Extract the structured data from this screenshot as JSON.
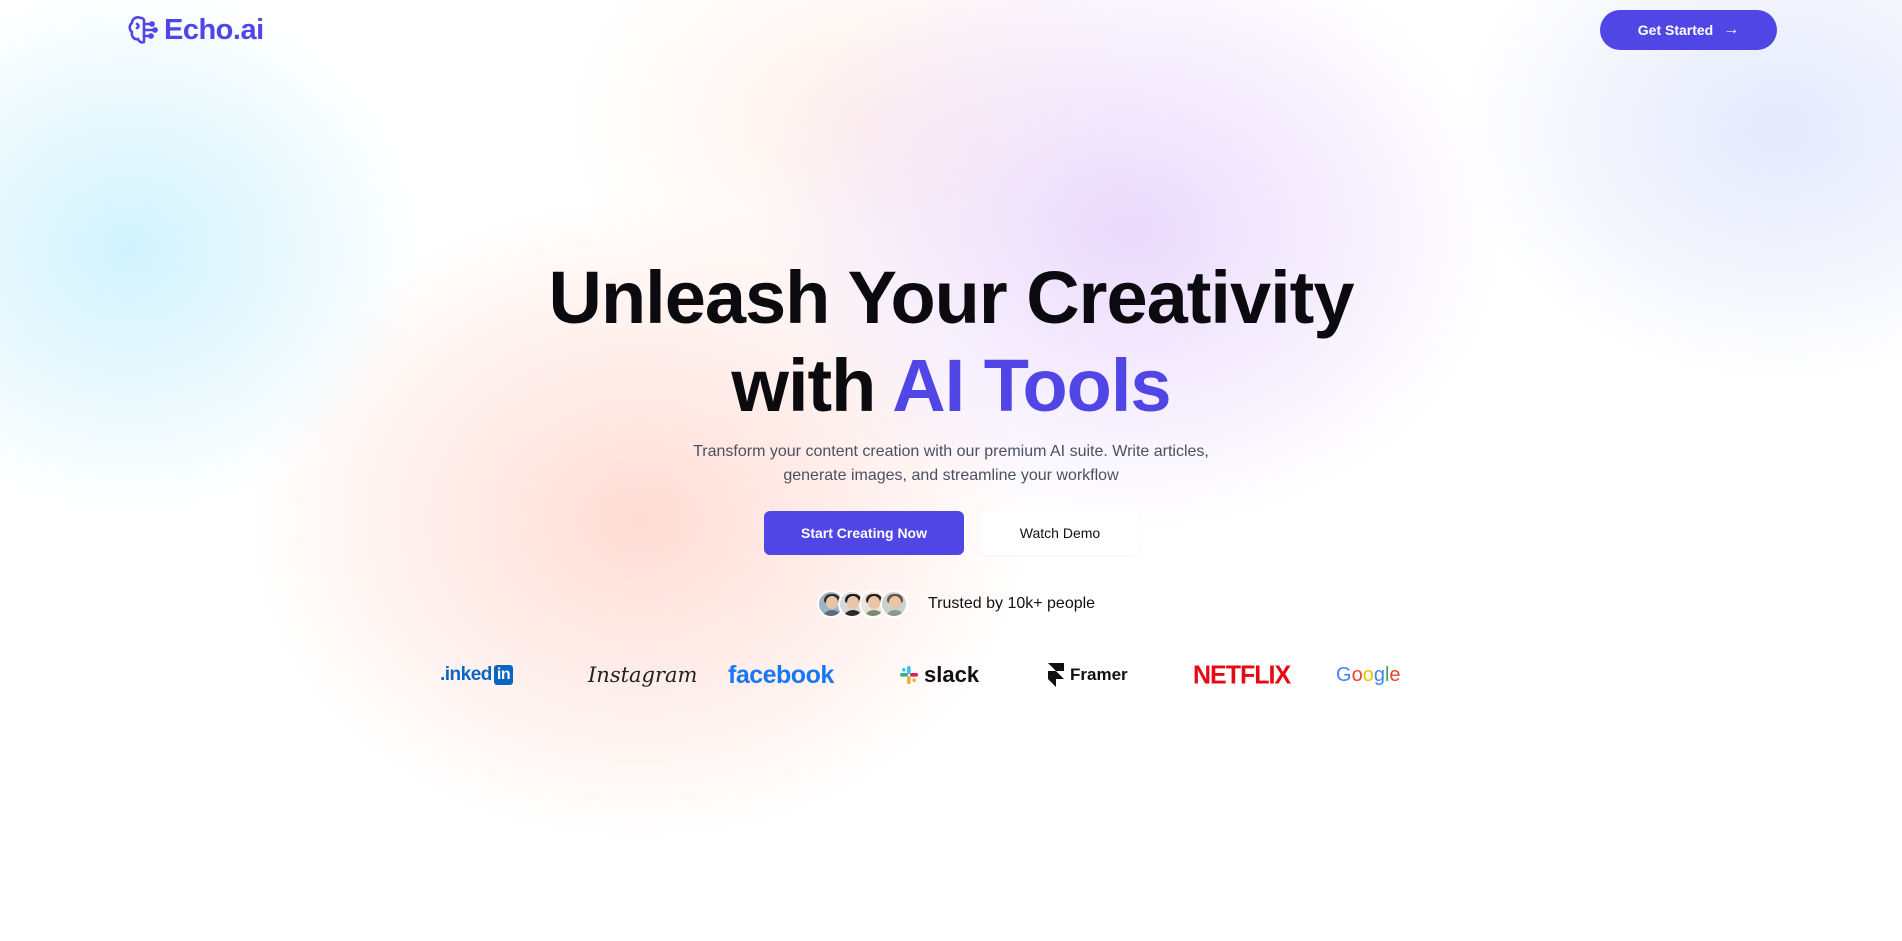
{
  "brand": {
    "name": "Echo.ai",
    "accent_color": "#4f46e5"
  },
  "header": {
    "cta_label": "Get Started",
    "cta_icon": "arrow-right-icon"
  },
  "hero": {
    "title_line1": "Unleash Your Creativity",
    "title_line2_prefix": "with ",
    "title_line2_accent": "AI Tools",
    "subtitle_line1": "Transform your content creation with our premium AI suite. Write articles,",
    "subtitle_line2": "generate images, and streamline your workflow",
    "primary_cta": "Start Creating Now",
    "secondary_cta": "Watch Demo",
    "trust_text": "Trusted by 10k+ people"
  },
  "partner_logos": [
    {
      "name": "linkedin",
      "text_prefix": ".inked",
      "text_box": "in",
      "color": "#0a66c2"
    },
    {
      "name": "instagram",
      "text": "Instagram",
      "color": "#222222"
    },
    {
      "name": "facebook",
      "text": "facebook",
      "color": "#1877f2"
    },
    {
      "name": "slack",
      "text": "slack",
      "color": "#111111"
    },
    {
      "name": "framer",
      "text": "Framer",
      "color": "#111111"
    },
    {
      "name": "netflix",
      "text": "NETFLIX",
      "color": "#e50914"
    },
    {
      "name": "google",
      "letters": [
        "G",
        "o",
        "o",
        "g",
        "l",
        "e"
      ],
      "colors": [
        "#4285f4",
        "#ea4335",
        "#fbbc05",
        "#4285f4",
        "#34a853",
        "#ea4335"
      ]
    }
  ]
}
